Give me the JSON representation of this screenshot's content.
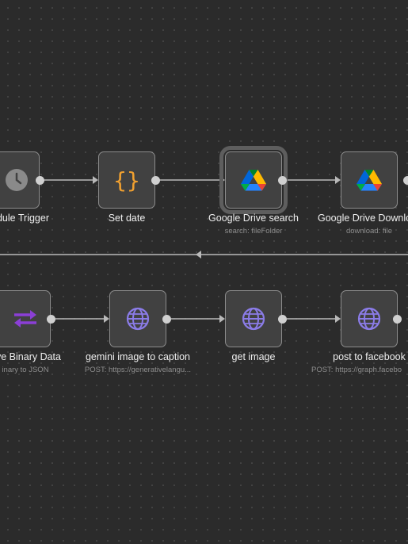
{
  "workflow": {
    "row1": [
      {
        "label": "dule Trigger",
        "sub": "",
        "icon": "clock-icon"
      },
      {
        "label": "Set date",
        "sub": "",
        "icon": "braces-icon"
      },
      {
        "label": "Google Drive search",
        "sub": "search: fileFolder",
        "icon": "google-drive-icon",
        "selected": true
      },
      {
        "label": "Google Drive Downlo",
        "sub": "download: file",
        "icon": "google-drive-icon"
      }
    ],
    "row2": [
      {
        "label": "ve Binary Data",
        "sub": "inary to JSON",
        "icon": "swap-arrows-icon"
      },
      {
        "label": "gemini image to caption",
        "sub": "POST: https://generativelangu...",
        "icon": "globe-icon"
      },
      {
        "label": "get image",
        "sub": "",
        "icon": "globe-icon"
      },
      {
        "label": "post to facebook",
        "sub": "POST: https://graph.facebo",
        "icon": "globe-icon"
      }
    ]
  },
  "colors": {
    "canvas": "#2b2b2b",
    "node": "#414141",
    "edge": "#b9b9b9",
    "trigger_icon": "#8a8a8a",
    "set_icon": "#f0a030",
    "http_icon": "#8b7ce8",
    "convert_icon": "#8b3fd6"
  }
}
